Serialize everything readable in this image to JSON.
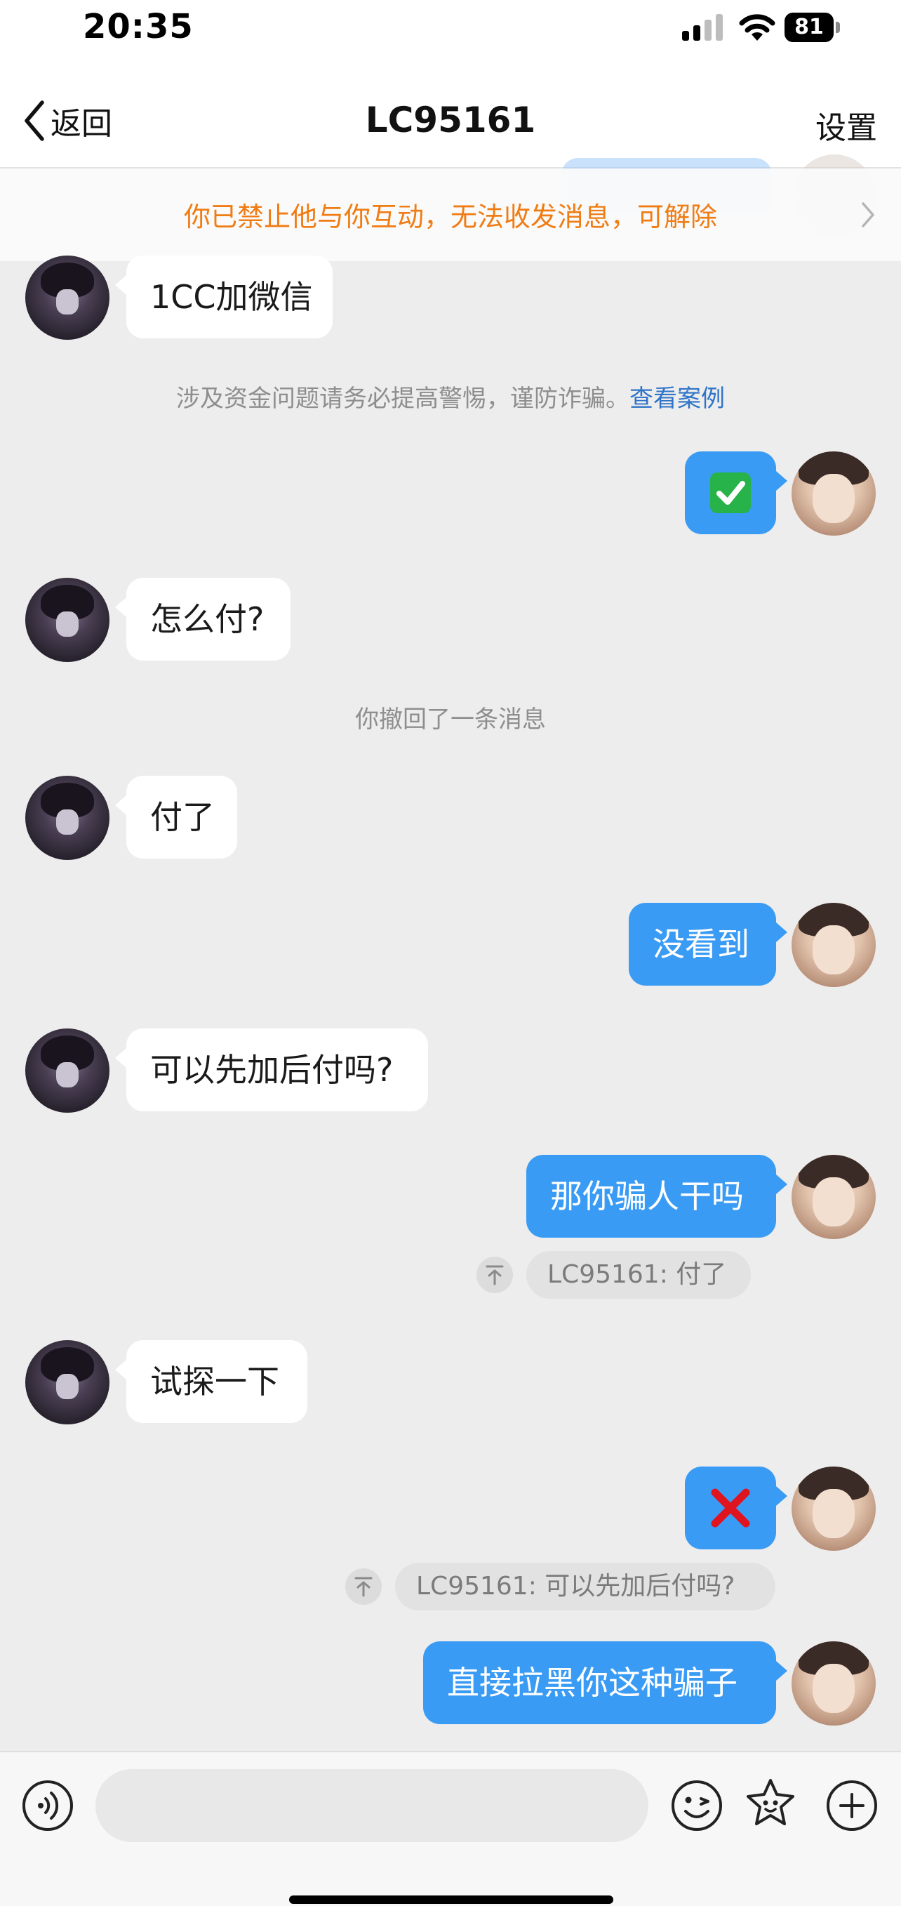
{
  "status_bar": {
    "time": "20:35",
    "battery": "81"
  },
  "nav": {
    "back_label": "返回",
    "title": "LC95161",
    "settings_label": "设置"
  },
  "banner": {
    "text": "你已禁止他与你互动，无法收发消息，可解除"
  },
  "messages": {
    "m1_text": "1CC加微信",
    "warning_text": "涉及资金问题请务必提高警惕，谨防诈骗。",
    "warning_link": "查看案例",
    "m2_emoji": "check-mark-button-emoji",
    "m3_text": "怎么付?",
    "recall_text": "你撤回了一条消息",
    "m4_text": "付了",
    "m5_text": "没看到",
    "m6_text": "可以先加后付吗?",
    "m7_text": "那你骗人干吗",
    "q1_text": "LC95161: 付了",
    "m8_text": "试探一下",
    "m9_emoji": "cross-mark-emoji",
    "q2_text": "LC95161: 可以先加后付吗?",
    "m10_text": "直接拉黑你这种骗子"
  },
  "input_bar": {
    "placeholder": "",
    "icons": [
      "voice-icon",
      "emoji-face-icon",
      "sticker-star-icon",
      "plus-icon"
    ]
  },
  "colors": {
    "accent_blue": "#3a9bf5",
    "banner_orange": "#f07c14",
    "link_blue": "#2f74c8",
    "background": "#ededed"
  }
}
